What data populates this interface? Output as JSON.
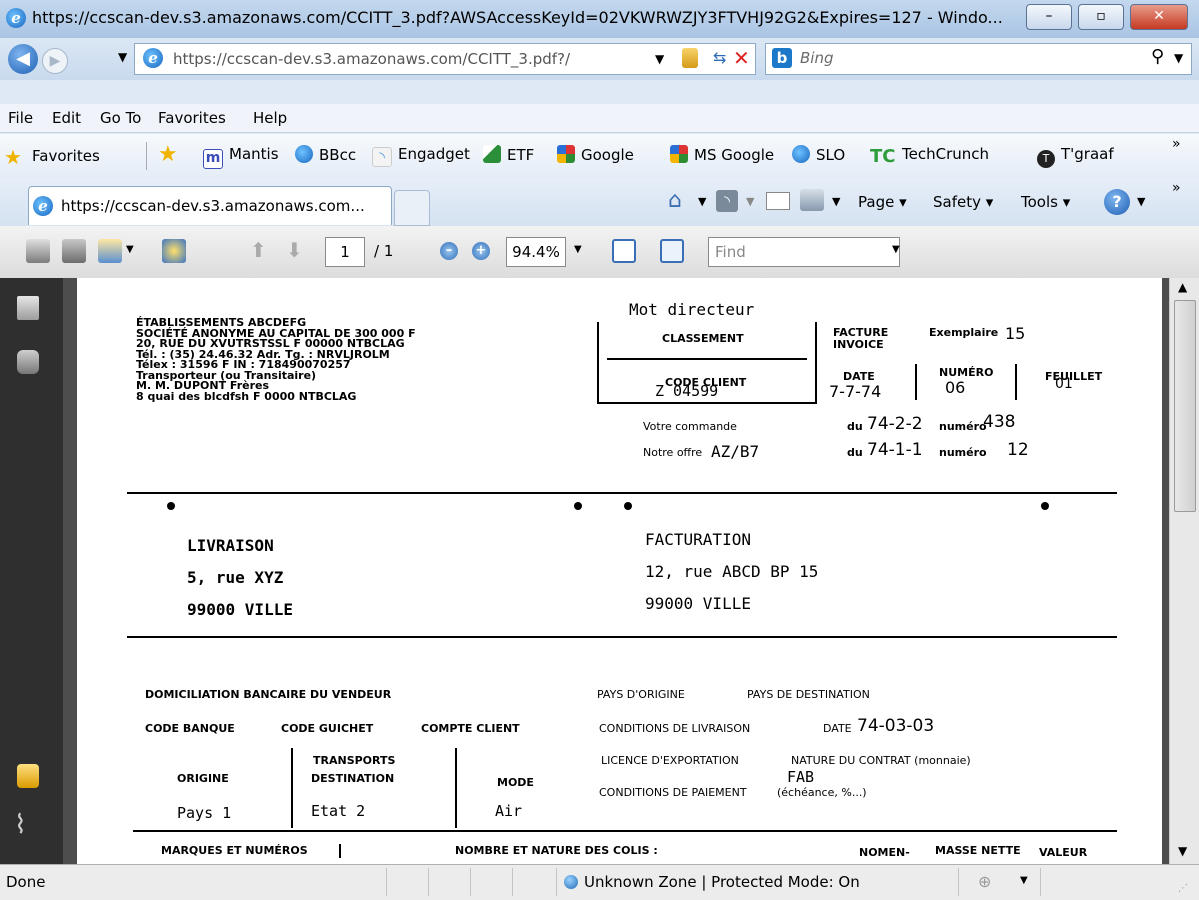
{
  "window": {
    "title": "https://ccscan-dev.s3.amazonaws.com/CCITT_3.pdf?AWSAccessKeyId=02VKWRWZJY3FTVHJ92G2&Expires=127 - Windo...",
    "minimize": "–",
    "maximize": "▫",
    "close": "✕"
  },
  "address": {
    "url": "https://ccscan-dev.s3.amazonaws.com/CCITT_3.pdf?/",
    "search_placeholder": "Bing"
  },
  "menu": [
    "File",
    "Edit",
    "Go To",
    "Favorites",
    "Help"
  ],
  "favorites": {
    "label": "Favorites",
    "items": [
      "Mantis",
      "BBcc",
      "Engadget",
      "ETF",
      "Google",
      "MS Google",
      "SLO",
      "TechCrunch",
      "T'graaf"
    ],
    "chevron": "»"
  },
  "tab": {
    "title": "https://ccscan-dev.s3.amazonaws.com...",
    "commands": [
      "Page ▾",
      "Safety ▾",
      "Tools ▾"
    ]
  },
  "pdf_toolbar": {
    "page_current": "1",
    "page_total": "/ 1",
    "zoom": "94.4%",
    "find_placeholder": "Find"
  },
  "document": {
    "sender": [
      "ÉTABLISSEMENTS ABCDEFG",
      "SOCIÉTÉ ANONYME AU CAPITAL DE 300 000 F",
      "20, RUE DU XVUTRSTSSL F 00000 NTBCLAG",
      "Tél. : (35) 24.46.32 Adr. Tg. : NRVLJROLM",
      "Télex : 31596 F IN : 718490070257",
      "Transporteur (ou Transitaire)",
      "M. M. DUPONT Frères",
      "8 quai des blcdfsh F 0000 NTBCLAG"
    ],
    "mot_directeur": "Mot directeur",
    "classement": "CLASSEMENT",
    "facture": "FACTURE",
    "invoice": "INVOICE",
    "exemplaire_label": "Exemplaire",
    "exemplaire_value": "15",
    "code_client_label": "CODE CLIENT",
    "code_client_value": "Z 04599",
    "date_label": "DATE",
    "date_value": "7-7-74",
    "numero_label": "NUMÉRO",
    "numero_value": "06",
    "feuillet_label": "FEUILLET",
    "feuillet_value": "01",
    "votre_commande": "Votre commande",
    "commande_du": "du",
    "commande_date": "74-2-2",
    "commande_numero_label": "numéro",
    "commande_numero": "438",
    "notre_offre": "Notre offre",
    "offre_value": "AZ/B7",
    "offre_du": "du",
    "offre_date": "74-1-1",
    "offre_numero_label": "numéro",
    "offre_numero": "12",
    "livraison": [
      "LIVRAISON",
      "5, rue XYZ",
      "99000 VILLE"
    ],
    "facturation": [
      "FACTURATION",
      "12, rue ABCD BP 15",
      "99000 VILLE"
    ],
    "domiciliation": "DOMICILIATION BANCAIRE DU VENDEUR",
    "code_banque": "CODE BANQUE",
    "code_guichet": "CODE GUICHET",
    "compte_client": "COMPTE CLIENT",
    "pays_origine": "PAYS D'ORIGINE",
    "pays_destination": "PAYS DE DESTINATION",
    "conditions_livraison": "CONDITIONS DE LIVRAISON",
    "cond_date_label": "DATE",
    "cond_date_value": "74-03-03",
    "transports": "TRANSPORTS",
    "origine": "ORIGINE",
    "destination": "DESTINATION",
    "mode": "MODE",
    "licence": "LICENCE D'EXPORTATION",
    "nature_contrat": "NATURE DU CONTRAT (monnaie)",
    "fab": "FAB",
    "conditions_paiement": "CONDITIONS DE PAIEMENT",
    "paiement_detail": "(échéance, %...)",
    "origine_value": "Pays 1",
    "destination_value": "Etat 2",
    "mode_value": "Air",
    "table_headers": [
      "MARQUES ET NUMÉROS",
      "NOMBRE ET NATURE DES COLIS :",
      "NOMEN-",
      "MASSE NETTE",
      "VALEUR"
    ]
  },
  "status": {
    "text": "Done",
    "zone": "Unknown Zone | Protected Mode: On"
  }
}
